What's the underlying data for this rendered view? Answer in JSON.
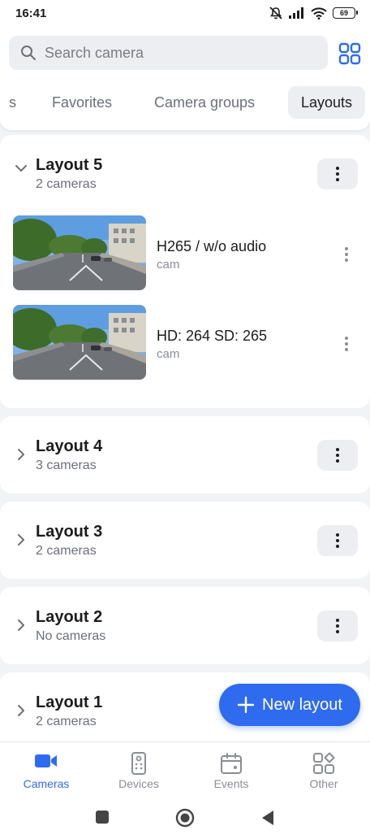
{
  "status_bar": {
    "time": "16:41",
    "battery": "69"
  },
  "search": {
    "placeholder": "Search camera",
    "value": ""
  },
  "tabs": [
    {
      "label": "s",
      "active": false
    },
    {
      "label": "Favorites",
      "active": false
    },
    {
      "label": "Camera groups",
      "active": false
    },
    {
      "label": "Layouts",
      "active": true
    }
  ],
  "layouts": [
    {
      "name": "Layout 5",
      "count": "2 cameras",
      "expanded": true,
      "cameras": [
        {
          "title": "H265 / w/o audio",
          "subtitle": "cam"
        },
        {
          "title": "HD: 264 SD: 265",
          "subtitle": "cam"
        }
      ]
    },
    {
      "name": "Layout 4",
      "count": "3 cameras",
      "expanded": false
    },
    {
      "name": "Layout 3",
      "count": "2 cameras",
      "expanded": false
    },
    {
      "name": "Layout 2",
      "count": "No cameras",
      "expanded": false
    },
    {
      "name": "Layout 1",
      "count": "2 cameras",
      "expanded": false
    }
  ],
  "fab": {
    "label": "New layout",
    "icon": "plus-icon"
  },
  "bottom_nav": [
    {
      "label": "Cameras",
      "icon": "video-camera-icon",
      "active": true
    },
    {
      "label": "Devices",
      "icon": "remote-control-icon",
      "active": false
    },
    {
      "label": "Events",
      "icon": "calendar-icon",
      "active": false
    },
    {
      "label": "Other",
      "icon": "apps-grid-icon",
      "active": false
    }
  ],
  "colors": {
    "accent": "#2f6bef",
    "background": "#f2f3f5",
    "surface": "#ffffff",
    "chip": "#eceef1",
    "text_primary": "#1c1c1e",
    "text_secondary": "#6c6f77"
  }
}
